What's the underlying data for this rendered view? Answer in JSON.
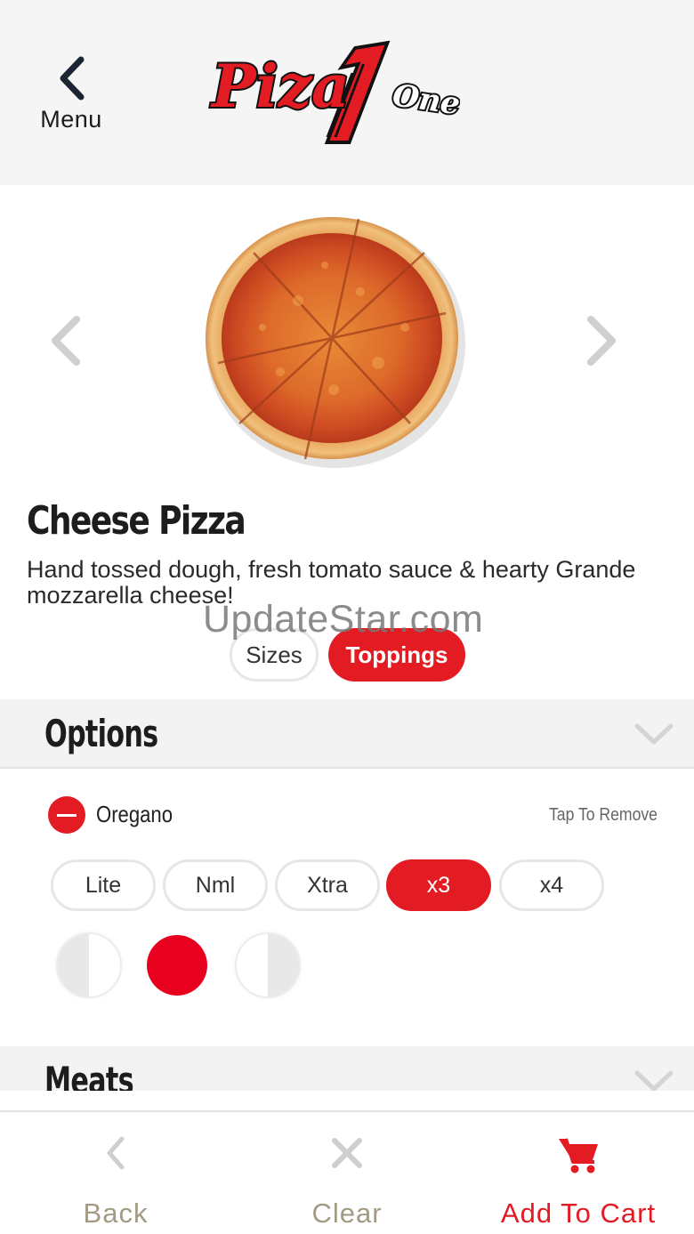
{
  "header": {
    "menu_label": "Menu",
    "logo_text": "Piza",
    "logo_one": "One"
  },
  "product": {
    "title": "Cheese Pizza",
    "description": "Hand tossed dough, fresh tomato sauce & hearty Grande mozzarella cheese!"
  },
  "watermark": "UpdateStar.com",
  "tabs": [
    {
      "label": "Sizes",
      "active": false
    },
    {
      "label": "Toppings",
      "active": true
    }
  ],
  "options": {
    "section_title": "Options",
    "topping": {
      "name": "Oregano",
      "hint": "Tap To Remove"
    },
    "amounts": [
      {
        "label": "Lite",
        "active": false
      },
      {
        "label": "Nml",
        "active": false
      },
      {
        "label": "Xtra",
        "active": false
      },
      {
        "label": "x3",
        "active": true
      },
      {
        "label": "x4",
        "active": false
      }
    ],
    "coverage_selected": "whole"
  },
  "next_section_title": "Meats",
  "bottom_bar": {
    "back_label": "Back",
    "clear_label": "Clear",
    "cart_label": "Add To Cart"
  },
  "colors": {
    "accent": "#e31b23",
    "muted_label": "#a39a84",
    "header_bg": "#f5f5f5"
  }
}
